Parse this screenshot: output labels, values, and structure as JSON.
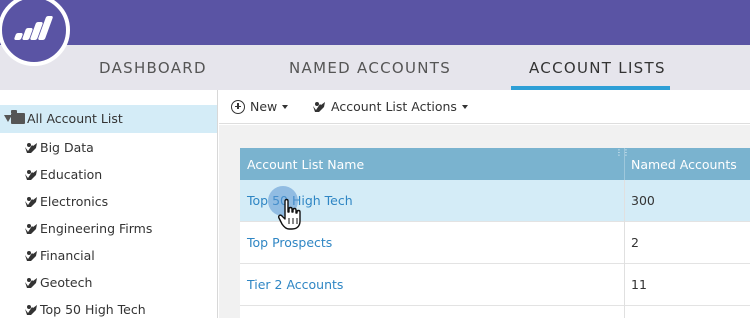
{
  "app": {
    "brand": "marketo-logo",
    "accent": "#5a54a4",
    "tab_accent": "#2e9fd6"
  },
  "tabs": [
    {
      "label": "DASHBOARD",
      "active": false
    },
    {
      "label": "NAMED ACCOUNTS",
      "active": false
    },
    {
      "label": "ACCOUNT LISTS",
      "active": true
    }
  ],
  "sidebar": {
    "root": {
      "label": "All Account List",
      "icon": "folder-icon"
    },
    "items": [
      {
        "label": "Big Data",
        "icon": "account-list-icon"
      },
      {
        "label": "Education",
        "icon": "account-list-icon"
      },
      {
        "label": "Electronics",
        "icon": "account-list-icon"
      },
      {
        "label": "Engineering Firms",
        "icon": "account-list-icon"
      },
      {
        "label": "Financial",
        "icon": "account-list-icon"
      },
      {
        "label": "Geotech",
        "icon": "account-list-icon"
      },
      {
        "label": "Top 50 High Tech",
        "icon": "account-list-icon"
      }
    ]
  },
  "toolbar": {
    "new_label": "New",
    "actions_label": "Account List Actions"
  },
  "table": {
    "columns": [
      "Account List Name",
      "Named Accounts"
    ],
    "rows": [
      {
        "name": "Top 50 High Tech",
        "count": "300",
        "selected": true
      },
      {
        "name": "Top Prospects",
        "count": "2",
        "selected": false
      },
      {
        "name": "Tier 2 Accounts",
        "count": "11",
        "selected": false
      }
    ]
  }
}
